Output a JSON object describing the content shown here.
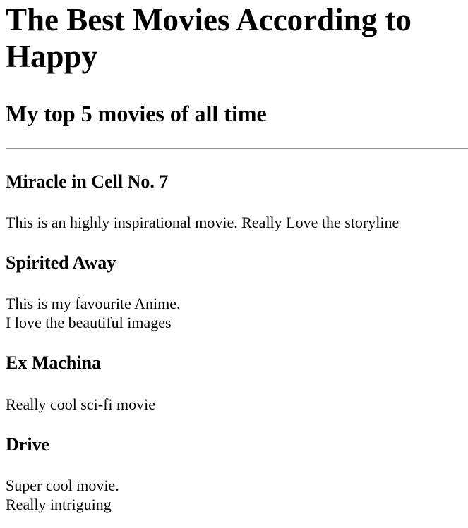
{
  "page": {
    "title": "The Best Movies According to Happy",
    "subtitle": "My top 5 movies of all time"
  },
  "movies": [
    {
      "title": "Miracle in Cell No. 7",
      "lines": [
        "This is an highly inspirational movie. Really Love the storyline"
      ]
    },
    {
      "title": "Spirited Away",
      "lines": [
        "This is my favourite Anime.",
        "I love the beautiful images"
      ]
    },
    {
      "title": "Ex Machina",
      "lines": [
        "Really cool sci-fi movie"
      ]
    },
    {
      "title": "Drive",
      "lines": [
        "Super cool movie.",
        "Really intriguing"
      ]
    }
  ]
}
